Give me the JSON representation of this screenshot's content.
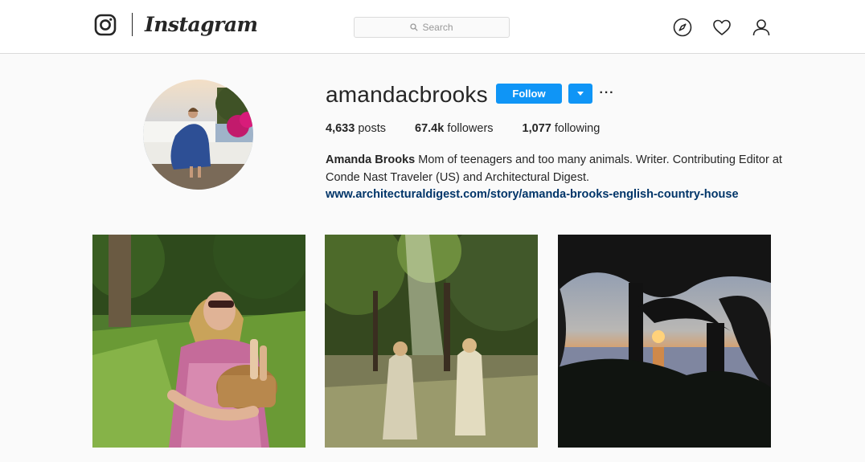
{
  "header": {
    "brand": "Instagram",
    "search": {
      "placeholder": "Search"
    },
    "icons": [
      "camera-logo-icon",
      "compass-icon",
      "heart-icon",
      "user-icon"
    ]
  },
  "profile": {
    "username": "amandacbrooks",
    "follow_label": "Follow",
    "more_label": "···",
    "stats": {
      "posts_value": "4,633",
      "posts_label": "posts",
      "followers_value": "67.4k",
      "followers_label": "followers",
      "following_value": "1,077",
      "following_label": "following"
    },
    "bio": {
      "full_name": "Amanda Brooks",
      "text": "Mom of teenagers and too many animals. Writer. Contributing Editor at Conde Nast Traveler (US) and Architectural Digest.",
      "link": "www.architecturaldigest.com/story/amanda-brooks-english-country-house"
    }
  },
  "colors": {
    "accent": "#0f95f6",
    "link": "#003569",
    "text": "#262626",
    "background": "#fafafa"
  }
}
